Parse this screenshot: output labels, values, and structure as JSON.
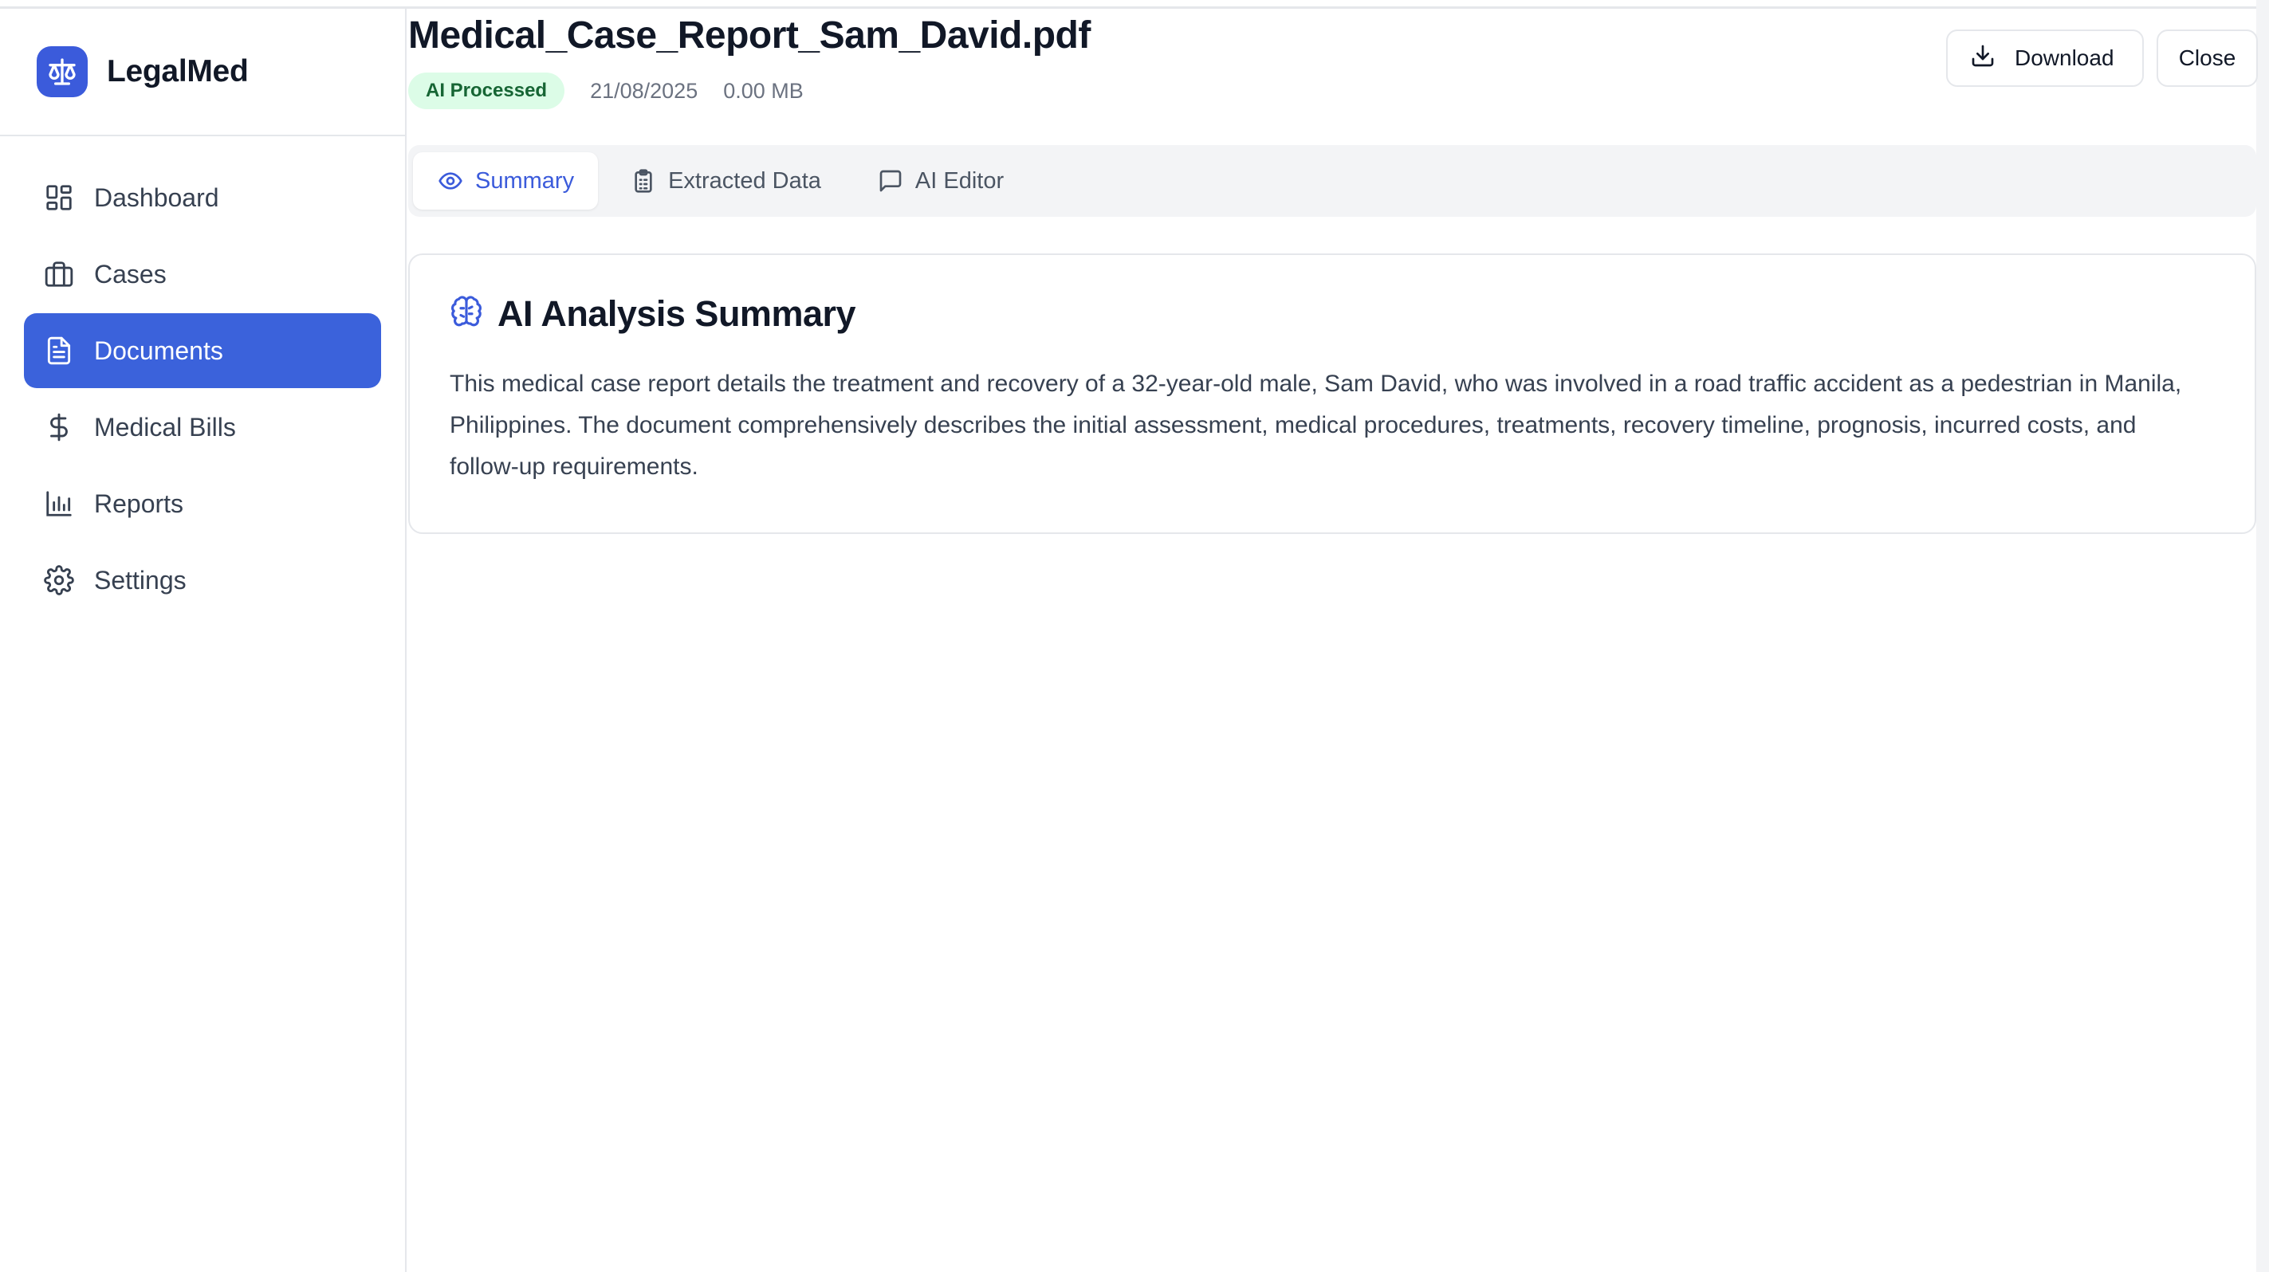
{
  "sidebar": {
    "brand": {
      "name": "LegalMed",
      "icon": "scale-icon"
    },
    "items": [
      {
        "label": "Dashboard",
        "icon": "dashboard-icon",
        "active": false
      },
      {
        "label": "Cases",
        "icon": "briefcase-icon",
        "active": false
      },
      {
        "label": "Documents",
        "icon": "document-icon",
        "active": true
      },
      {
        "label": "Medical Bills",
        "icon": "dollar-icon",
        "active": false
      },
      {
        "label": "Reports",
        "icon": "bar-chart-icon",
        "active": false
      },
      {
        "label": "Settings",
        "icon": "gear-icon",
        "active": false
      }
    ]
  },
  "document": {
    "title": "Medical_Case_Report_Sam_David.pdf",
    "status_badge": "AI Processed",
    "date": "21/08/2025",
    "size": "0.00 MB"
  },
  "actions": {
    "download_label": "Download",
    "close_label": "Close"
  },
  "tabs": [
    {
      "label": "Summary",
      "icon": "eye-icon",
      "active": true
    },
    {
      "label": "Extracted Data",
      "icon": "clipboard-icon",
      "active": false
    },
    {
      "label": "AI Editor",
      "icon": "chat-icon",
      "active": false
    }
  ],
  "summary": {
    "title": "AI Analysis Summary",
    "icon": "brain-icon",
    "text": "This medical case report details the treatment and recovery of a 32-year-old male, Sam David, who was involved in a road traffic accident as a pedestrian in Manila, Philippines. The document comprehensively describes the initial assessment, medical procedures, treatments, recovery timeline, prognosis, incurred costs, and follow-up requirements."
  },
  "colors": {
    "accent": "#3b62db",
    "badge_bg": "#dcfce7",
    "badge_text": "#166534"
  }
}
